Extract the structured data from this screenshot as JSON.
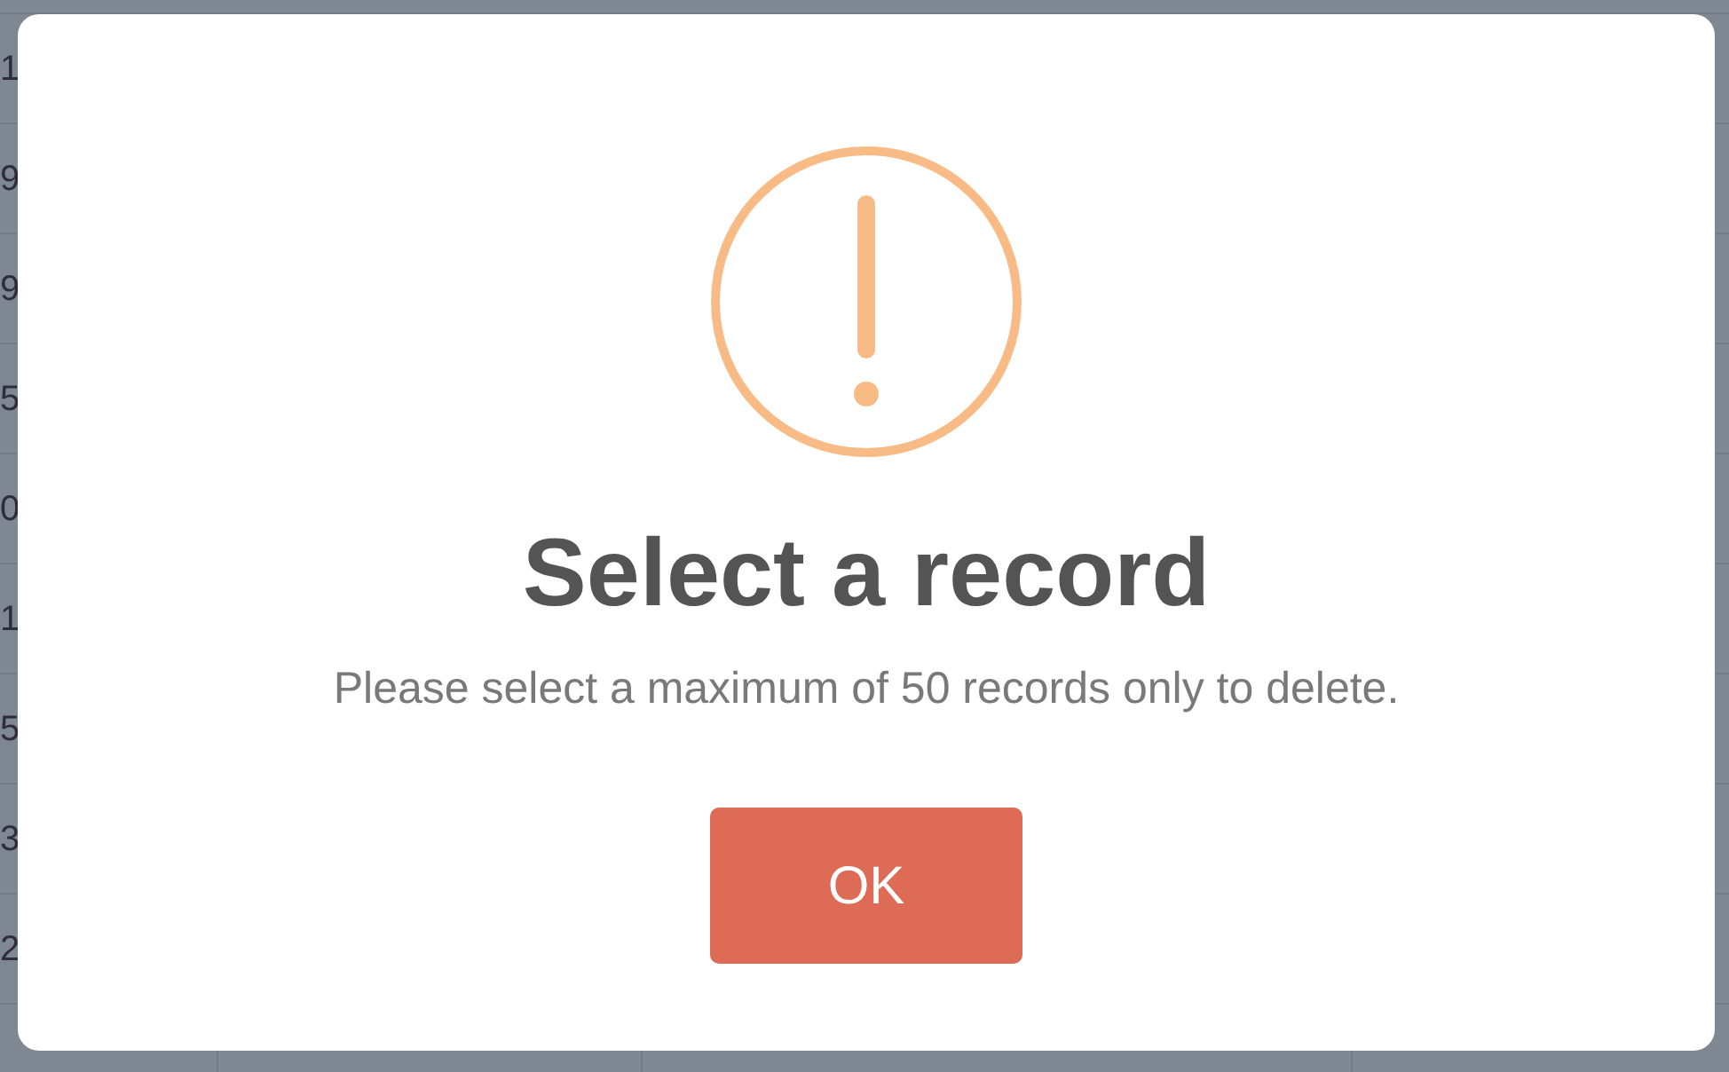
{
  "background_table": {
    "first_column_fragments": [
      "1",
      "9",
      "9",
      "5",
      "0",
      "1",
      "5",
      "3",
      "2"
    ]
  },
  "dialog": {
    "title": "Select a record",
    "message": "Please select a maximum of 50 records only to delete.",
    "buttons": [
      "OK"
    ]
  }
}
